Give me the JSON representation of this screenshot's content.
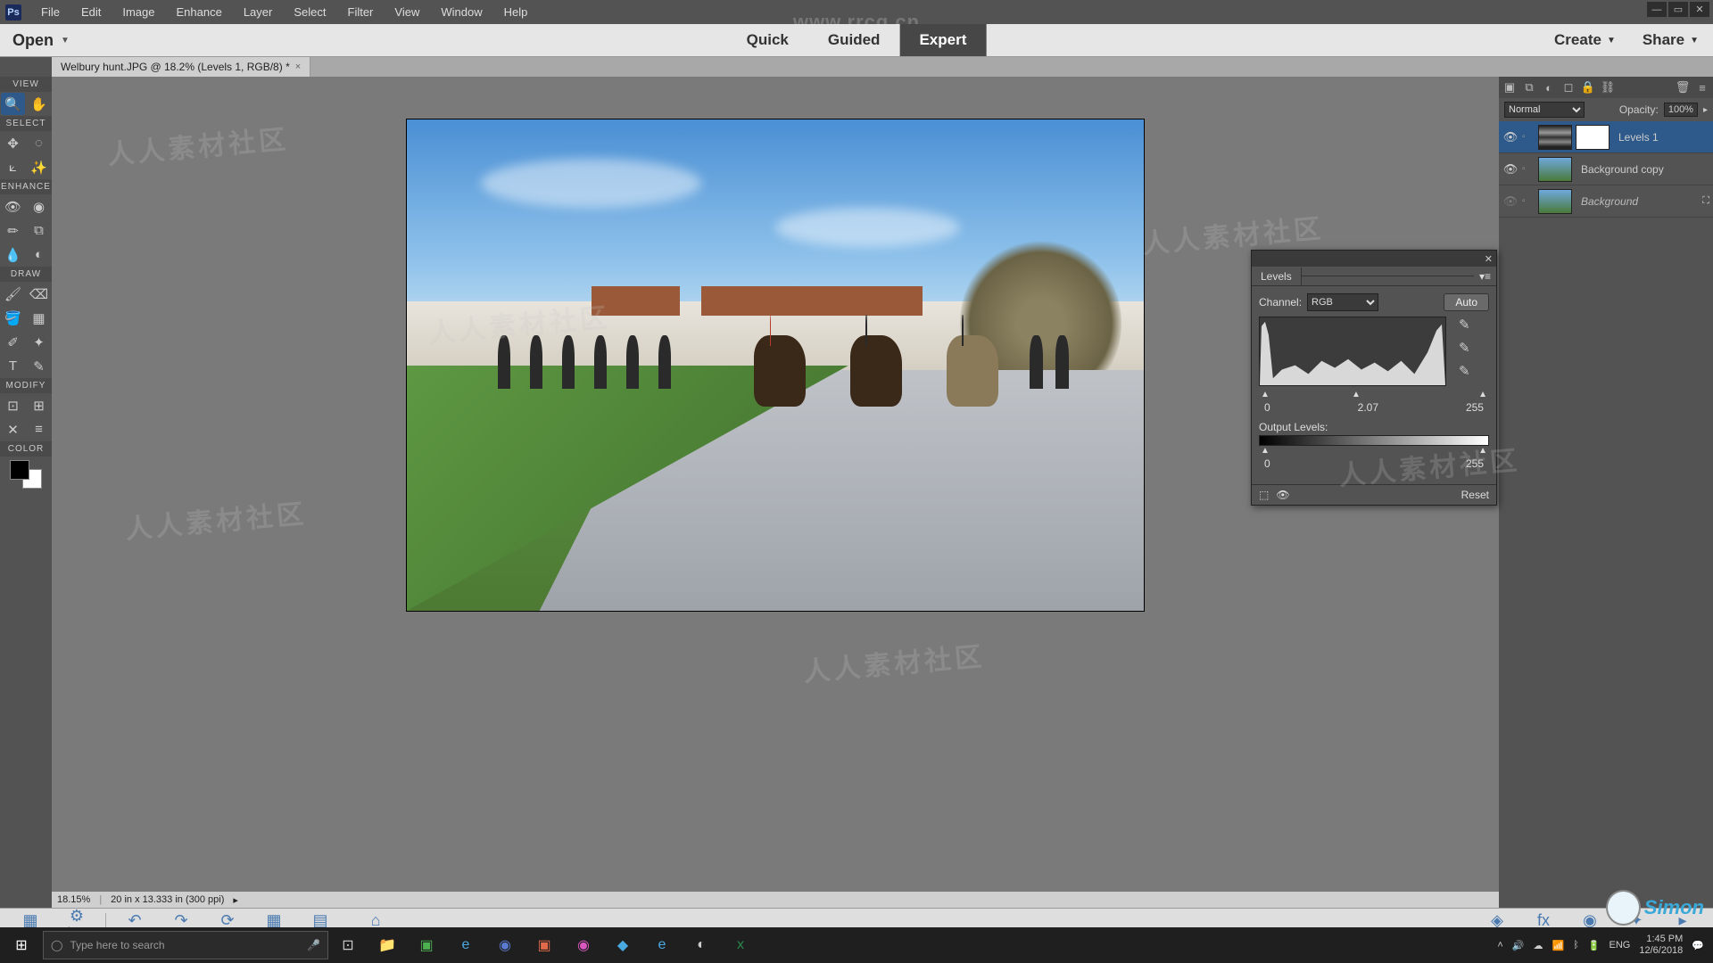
{
  "menu": {
    "items": [
      "File",
      "Edit",
      "Image",
      "Enhance",
      "Layer",
      "Select",
      "Filter",
      "View",
      "Window",
      "Help"
    ]
  },
  "watermark_url": "www.rrcg.cn",
  "modebar": {
    "open": "Open",
    "tabs": [
      "Quick",
      "Guided",
      "Expert"
    ],
    "active": "Expert",
    "create": "Create",
    "share": "Share"
  },
  "doc_tab": "Welbury hunt.JPG @ 18.2% (Levels 1, RGB/8) *",
  "toolbox": {
    "sections": {
      "view": "VIEW",
      "select": "SELECT",
      "enhance": "ENHANCE",
      "draw": "DRAW",
      "modify": "MODIFY",
      "color": "COLOR"
    }
  },
  "status": {
    "zoom": "18.15%",
    "dims": "20 in x 13.333 in (300 ppi)"
  },
  "layers": {
    "blend": "Normal",
    "opacity_label": "Opacity:",
    "opacity": "100%",
    "rows": [
      {
        "visible": true,
        "name": "Levels 1",
        "style": "normal",
        "mask": true,
        "active": true
      },
      {
        "visible": true,
        "name": "Background copy",
        "style": "normal",
        "mask": false,
        "active": false
      },
      {
        "visible": false,
        "name": "Background",
        "style": "italic",
        "mask": false,
        "active": false
      }
    ]
  },
  "levels": {
    "title": "Levels",
    "channel_label": "Channel:",
    "channel": "RGB",
    "auto": "Auto",
    "input": {
      "black": "0",
      "mid": "2.07",
      "white": "255"
    },
    "output_label": "Output Levels:",
    "output": {
      "black": "0",
      "white": "255"
    },
    "reset": "Reset"
  },
  "panelbar": {
    "left": [
      "Photo Bin",
      "Tool Options"
    ],
    "mid": [
      "Undo",
      "Redo",
      "Rotate",
      "Layout",
      "Organizer",
      "Home Screen"
    ],
    "right": [
      "Layers",
      "Effects",
      "Filters",
      "Styles",
      "More"
    ]
  },
  "taskbar": {
    "search_placeholder": "Type here to search",
    "time": "1:45 PM",
    "date": "12/6/2018",
    "lang": "ENG"
  },
  "logo": "Simon"
}
